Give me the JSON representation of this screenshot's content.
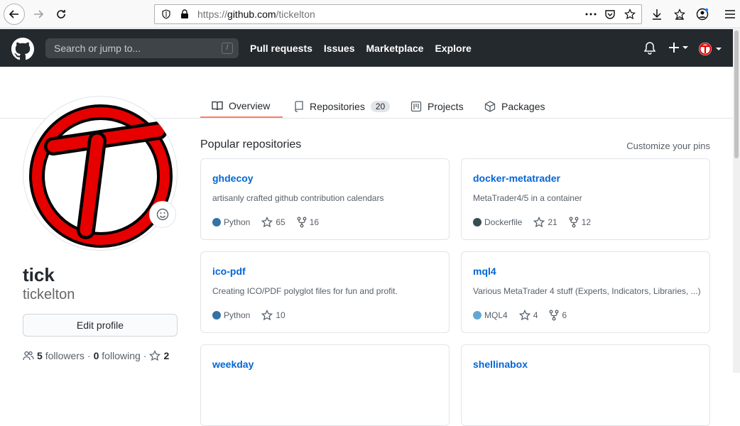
{
  "browser": {
    "url_scheme": "https://",
    "url_host": "github.com",
    "url_path": "/tickelton"
  },
  "header": {
    "search_placeholder": "Search or jump to...",
    "search_key": "/",
    "nav": [
      "Pull requests",
      "Issues",
      "Marketplace",
      "Explore"
    ]
  },
  "tabs": {
    "overview": "Overview",
    "repositories": "Repositories",
    "repositories_count": "20",
    "projects": "Projects",
    "packages": "Packages"
  },
  "profile": {
    "name": "tick",
    "login": "tickelton",
    "edit_label": "Edit profile",
    "followers_count": "5",
    "followers_label": "followers",
    "following_count": "0",
    "following_label": "following",
    "stars_count": "2"
  },
  "popular": {
    "title": "Popular repositories",
    "customize": "Customize your pins",
    "repos": [
      {
        "name": "ghdecoy",
        "desc": "artisanly crafted github contribution calendars",
        "lang": "Python",
        "lang_color": "#3572A5",
        "stars": "65",
        "forks": "16"
      },
      {
        "name": "docker-metatrader",
        "desc": "MetaTrader4/5 in a container",
        "lang": "Dockerfile",
        "lang_color": "#384d54",
        "stars": "21",
        "forks": "12"
      },
      {
        "name": "ico-pdf",
        "desc": "Creating ICO/PDF polyglot files for fun and profit.",
        "lang": "Python",
        "lang_color": "#3572A5",
        "stars": "10",
        "forks": ""
      },
      {
        "name": "mql4",
        "desc": "Various MetaTrader 4 stuff (Experts, Indicators, Libraries, ...)",
        "lang": "MQL4",
        "lang_color": "#62A8D6",
        "stars": "4",
        "forks": "6"
      },
      {
        "name": "weekday",
        "desc": "",
        "lang": "",
        "lang_color": "",
        "stars": "",
        "forks": ""
      },
      {
        "name": "shellinabox",
        "desc": "",
        "lang": "",
        "lang_color": "",
        "stars": "",
        "forks": ""
      }
    ]
  }
}
